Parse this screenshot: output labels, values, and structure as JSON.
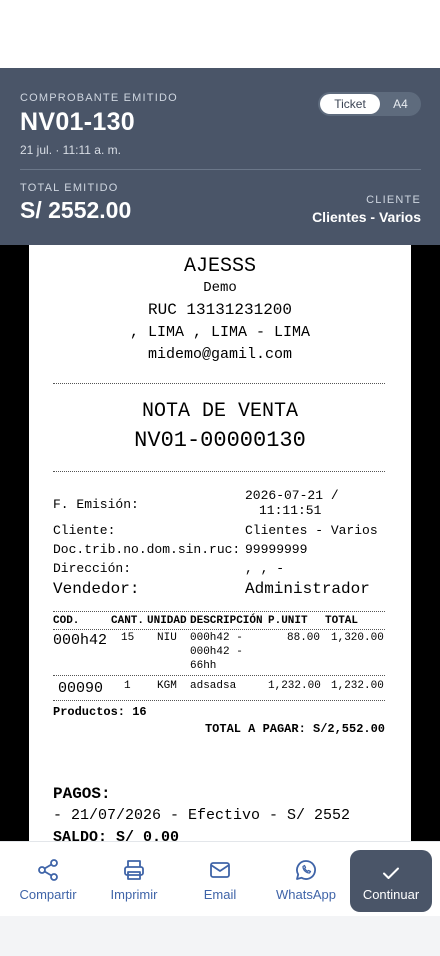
{
  "header": {
    "kicker": "COMPROBANTE EMITIDO",
    "number": "NV01-130",
    "date": "21 jul. · 11:11 a. m.",
    "format_options": [
      "Ticket",
      "A4"
    ],
    "selected_format": "Ticket",
    "total_label": "TOTAL EMITIDO",
    "total_value": "S/ 2552.00",
    "client_label": "CLIENTE",
    "client_value": "Clientes - Varios"
  },
  "ticket": {
    "company": "AJESSS",
    "subtitle": "Demo",
    "ruc": "RUC 13131231200",
    "address": ", LIMA , LIMA - LIMA",
    "email": "midemo@gamil.com",
    "doc_type": "NOTA DE VENTA",
    "doc_number": "NV01-00000130",
    "fields": {
      "emision_label": "F. Emisión:",
      "emision_value_1": "2026-07-21 /",
      "emision_value_2": "11:11:51",
      "cliente_label": "Cliente:",
      "cliente_value": "Clientes - Varios",
      "doc_label": "Doc.trib.no.dom.sin.ruc:",
      "doc_value": "99999999",
      "direccion_label": "Dirección:",
      "direccion_value": ", , -",
      "vendedor_label": "Vendedor:",
      "vendedor_value": "Administrador"
    },
    "columns": [
      "COD.",
      "CANT.",
      "UNIDAD",
      "DESCRIPCIÓN",
      "P.UNIT",
      "TOTAL"
    ],
    "items": [
      {
        "cod": "000h42",
        "cant": "15",
        "unidad": "NIU",
        "desc_1": "000h42 -",
        "desc_2": "000h42 -",
        "desc_3": "66hh",
        "punit": "88.00",
        "total": "1,320.00"
      },
      {
        "cod": "00090",
        "cant": "1",
        "unidad": "KGM",
        "desc_1": "adsadsa",
        "punit": "1,232.00",
        "total": "1,232.00"
      }
    ],
    "productos": "Productos: 16",
    "total_pagar": "TOTAL A PAGAR: S/2,552.00",
    "pagos_label": "PAGOS:",
    "pagos_line": "- 21/07/2026 - Efectivo - S/ 2552",
    "saldo": "SALDO: S/ 0.00"
  },
  "footer": {
    "share": {
      "label": "Compartir",
      "icon": "share-icon"
    },
    "print": {
      "label": "Imprimir",
      "icon": "printer-icon"
    },
    "email": {
      "label": "Email",
      "icon": "mail-icon"
    },
    "whatsapp": {
      "label": "WhatsApp",
      "icon": "whatsapp-icon"
    },
    "continue": {
      "label": "Continuar",
      "icon": "check-icon"
    }
  },
  "colors": {
    "header_bg": "#4a5568",
    "accent_blue": "#3f64a8",
    "preview_bg": "#000000"
  }
}
